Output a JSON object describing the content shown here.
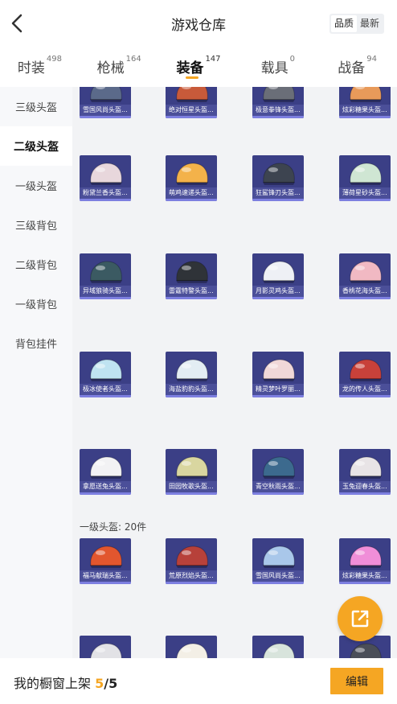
{
  "header": {
    "title": "游戏仓库",
    "sort_options": [
      "品质",
      "最新"
    ],
    "sort_selected": "品质"
  },
  "tabs": [
    {
      "label": "时装",
      "count": "498"
    },
    {
      "label": "枪械",
      "count": "164"
    },
    {
      "label": "装备",
      "count": "147",
      "active": true
    },
    {
      "label": "载具",
      "count": "0"
    },
    {
      "label": "战备",
      "count": "94"
    }
  ],
  "sidebar": [
    {
      "label": "三级头盔"
    },
    {
      "label": "二级头盔",
      "active": true
    },
    {
      "label": "一级头盔"
    },
    {
      "label": "三级背包"
    },
    {
      "label": "二级背包"
    },
    {
      "label": "一级背包"
    },
    {
      "label": "背包挂件"
    }
  ],
  "grid": {
    "rows": [
      [
        {
          "name": "雪国风尚头盔...",
          "color": "#5b6a8a"
        },
        {
          "name": "绝对恒星头盔...",
          "color": "#c85a3a"
        },
        {
          "name": "极意拳锋头盔...",
          "color": "#6a6e78"
        },
        {
          "name": "炫彩糖果头盔...",
          "color": "#e89a5a"
        }
      ],
      [
        {
          "name": "粉黛兰香头盔...",
          "color": "#e8d7dc"
        },
        {
          "name": "萌鸡速递头盔...",
          "color": "#f3b24a"
        },
        {
          "name": "狂鲨锋刃头盔...",
          "color": "#3d4450"
        },
        {
          "name": "薄荷星砂头盔...",
          "color": "#cfe6d3"
        }
      ],
      [
        {
          "name": "异域狼骑头盔...",
          "color": "#3b5a62"
        },
        {
          "name": "雷霆特警头盔...",
          "color": "#2f3338"
        },
        {
          "name": "月影灵鸡头盔...",
          "color": "#eef0f5"
        },
        {
          "name": "香桃花海头盔...",
          "color": "#f1b9c3"
        }
      ],
      [
        {
          "name": "极冰使者头盔...",
          "color": "#bfe3f1"
        },
        {
          "name": "海盐豹豹头盔...",
          "color": "#e3edf3"
        },
        {
          "name": "精灵梦叶罗丽...",
          "color": "#f0d8d8"
        },
        {
          "name": "龙的传人头盔...",
          "color": "#c8413a"
        }
      ],
      [
        {
          "name": "拿愿送兔头盔...",
          "color": "#f2f2f4"
        },
        {
          "name": "田园牧歌头盔...",
          "color": "#d9d6a0"
        },
        {
          "name": "青空秋雨头盔...",
          "color": "#3c6a8e"
        },
        {
          "name": "玉兔迎春头盔...",
          "color": "#e8e4e6"
        }
      ]
    ],
    "section_title": "一级头盔: 20件",
    "section_rows": [
      [
        {
          "name": "福马献瑞头盔...",
          "color": "#e2562e"
        },
        {
          "name": "荒原烈焰头盔...",
          "color": "#b7413a"
        },
        {
          "name": "雪国风尚头盔...",
          "color": "#a9c7ea"
        },
        {
          "name": "炫彩糖果头盔...",
          "color": "#f08ed8"
        }
      ],
      [
        {
          "name": "",
          "color": "#e2e2e6"
        },
        {
          "name": "",
          "color": "#f3efe6"
        },
        {
          "name": "",
          "color": "#d8e4dc"
        },
        {
          "name": "",
          "color": "#4a4e58"
        }
      ]
    ]
  },
  "share_button": {
    "icon": "share-icon"
  },
  "bottom_bar": {
    "label": "我的橱窗上架",
    "current": "5",
    "separator": "/",
    "total": "5",
    "edit_label": "编辑"
  },
  "colors": {
    "accent": "#f5a623",
    "card_bg": "#3b3f86"
  }
}
